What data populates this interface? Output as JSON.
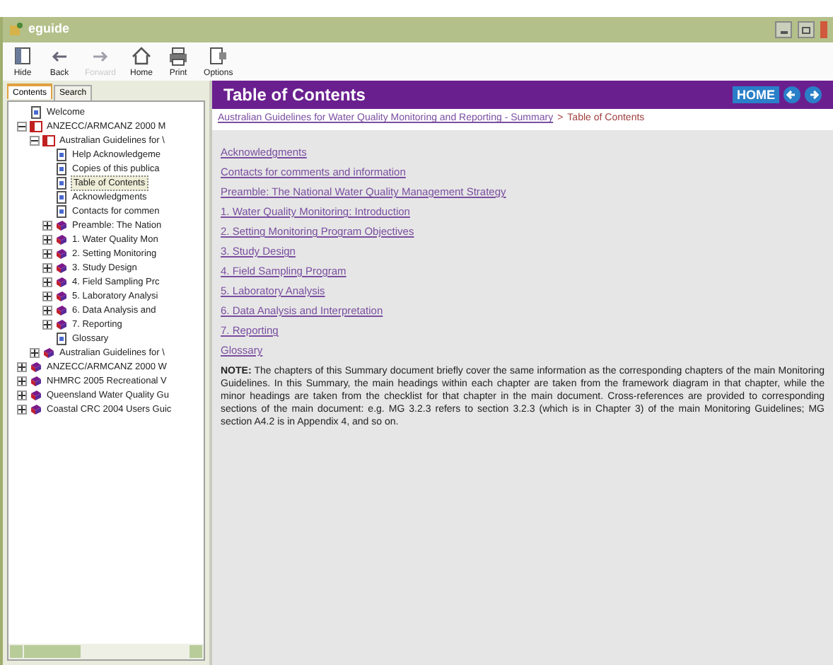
{
  "window": {
    "title": "eguide"
  },
  "toolbar": [
    {
      "label": "Hide",
      "disabled": false
    },
    {
      "label": "Back",
      "disabled": false
    },
    {
      "label": "Forward",
      "disabled": true
    },
    {
      "label": "Home",
      "disabled": false
    },
    {
      "label": "Print",
      "disabled": false
    },
    {
      "label": "Options",
      "disabled": false
    }
  ],
  "tabs": [
    {
      "label": "Contents",
      "selected": true
    },
    {
      "label": "Search",
      "selected": false
    }
  ],
  "tree": [
    {
      "kind": "page",
      "label": "Welcome",
      "selected": false
    },
    {
      "kind": "book",
      "label": "ANZECC/ARMCANZ 2000 M",
      "expanded": true,
      "selected": false,
      "children": [
        {
          "kind": "book",
          "label": "Australian Guidelines for \\",
          "expanded": true,
          "selected": false,
          "children": [
            {
              "kind": "page",
              "label": "Help Acknowledgeme",
              "selected": false
            },
            {
              "kind": "page",
              "label": "Copies of this publica",
              "selected": false
            },
            {
              "kind": "page",
              "label": "Table of Contents",
              "selected": true
            },
            {
              "kind": "page",
              "label": "Acknowledgments",
              "selected": false
            },
            {
              "kind": "page",
              "label": "Contacts for commen",
              "selected": false
            },
            {
              "kind": "book",
              "label": "Preamble: The Nation",
              "expanded": false,
              "selected": false
            },
            {
              "kind": "book",
              "label": "1. Water Quality Mon",
              "expanded": false,
              "selected": false
            },
            {
              "kind": "book",
              "label": "2. Setting Monitoring",
              "expanded": false,
              "selected": false
            },
            {
              "kind": "book",
              "label": "3. Study Design",
              "expanded": false,
              "selected": false
            },
            {
              "kind": "book",
              "label": "4. Field Sampling Prc",
              "expanded": false,
              "selected": false
            },
            {
              "kind": "book",
              "label": "5. Laboratory Analysi",
              "expanded": false,
              "selected": false
            },
            {
              "kind": "book",
              "label": "6. Data Analysis and",
              "expanded": false,
              "selected": false
            },
            {
              "kind": "book",
              "label": "7. Reporting",
              "expanded": false,
              "selected": false
            },
            {
              "kind": "page",
              "label": "Glossary",
              "selected": false
            }
          ]
        },
        {
          "kind": "book",
          "label": "Australian Guidelines for \\",
          "expanded": false,
          "selected": false
        }
      ]
    },
    {
      "kind": "book",
      "label": "ANZECC/ARMCANZ 2000 W",
      "expanded": false,
      "selected": false
    },
    {
      "kind": "book",
      "label": "NHMRC 2005 Recreational V",
      "expanded": false,
      "selected": false
    },
    {
      "kind": "book",
      "label": "Queensland Water Quality Gu",
      "expanded": false,
      "selected": false
    },
    {
      "kind": "book",
      "label": "Coastal CRC 2004 Users Guic",
      "expanded": false,
      "selected": false
    }
  ],
  "header": {
    "title": "Table of Contents",
    "home_button": "HOME"
  },
  "breadcrumb": {
    "link": "Australian Guidelines for Water Quality Monitoring and Reporting - Summary",
    "separator": ">",
    "current": "Table of Contents"
  },
  "links": [
    "Acknowledgments",
    "Contacts for comments and information",
    "Preamble: The National Water Quality Management Strategy",
    "1. Water Quality Monitoring: Introduction",
    "2. Setting Monitoring Program Objectives",
    "3. Study Design",
    "4. Field Sampling Program",
    "5. Laboratory Analysis",
    "6. Data Analysis and Interpretation",
    "7. Reporting",
    "Glossary"
  ],
  "note": "**NOTE:** The chapters of this Summary document briefly cover the same information as the corresponding chapters of the main Monitoring Guidelines. In this Summary, the main headings within each chapter are taken from the framework diagram in that chapter, while the minor headings are taken from the checklist for that chapter in the main document. Cross-references are provided to corresponding sections of the main document: e.g. MG 3.2.3 refers to section 3.2.3 (which is in Chapter 3) of the main Monitoring Guidelines; MG section A4.2 is in Appendix 4, and so on."
}
